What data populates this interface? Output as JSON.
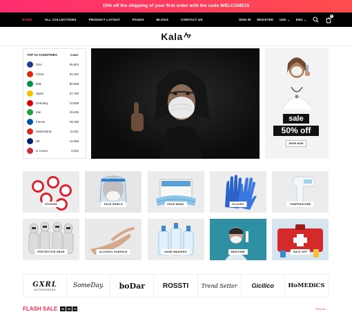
{
  "promo": {
    "text": "15% off the shipping of your first order with the code WELCOME15"
  },
  "nav": {
    "items": [
      "HOME",
      "ALL COLLECTIONS",
      "PRODUCT LAYOUT",
      "PAGES",
      "BLOGS",
      "CONTACT US"
    ],
    "signin": "SIGN IN",
    "register": "REGISTER",
    "currency": "USD",
    "language": "ENG",
    "cart_count": "0"
  },
  "logo": {
    "text": "Kala"
  },
  "countries": {
    "header_left": "TOP 10 COUNTRIES",
    "header_right": "Case",
    "rows": [
      {
        "name": "USA",
        "cases": "55,804",
        "color": "#1f3c88"
      },
      {
        "name": "China",
        "cases": "81,340",
        "color": "#de2910"
      },
      {
        "name": "Italy",
        "cases": "80,589",
        "color": "#009246"
      },
      {
        "name": "Spain",
        "cases": "57,786",
        "color": "#f1bf00"
      },
      {
        "name": "Germany",
        "cases": "43,938",
        "color": "#dd0000"
      },
      {
        "name": "Iran",
        "cases": "29,406",
        "color": "#239f40"
      },
      {
        "name": "France",
        "cases": "29,155",
        "color": "#0055a4"
      },
      {
        "name": "Switzerland",
        "cases": "11,811",
        "color": "#d52b1e"
      },
      {
        "name": "UK",
        "cases": "11,658",
        "color": "#012169"
      },
      {
        "name": "S. Korea",
        "cases": "9,332",
        "color": "#cd2e3a"
      }
    ]
  },
  "sale": {
    "word": "sale",
    "off": "50% off",
    "button": "SHOP NOW"
  },
  "categories": [
    {
      "label": "STICKER"
    },
    {
      "label": "FACE SHIELD"
    },
    {
      "label": "FACE MASK"
    },
    {
      "label": "GLOVES"
    },
    {
      "label": "TEMPERATURE"
    },
    {
      "label": "PROTECTIVE GEAR"
    },
    {
      "label": "ALCOHOL SURFACE"
    },
    {
      "label": "HAND WASHING"
    },
    {
      "label": "MEDICINE"
    },
    {
      "label": "SALE OFF"
    }
  ],
  "brands": {
    "gxrl": "GXRL",
    "gxrl_sub": "ACCESSORIES",
    "someday": "SomeDay.",
    "bodar": "boDar",
    "rossti": "ROSSTI",
    "trendsetter": "Trend Setter",
    "gicilico": "Gicilico",
    "homedics": "HoMEDiCS"
  },
  "flash": {
    "title": "FLASH SALE",
    "d": "00",
    "h": "30",
    "m": "11",
    "view_all": "View All"
  }
}
